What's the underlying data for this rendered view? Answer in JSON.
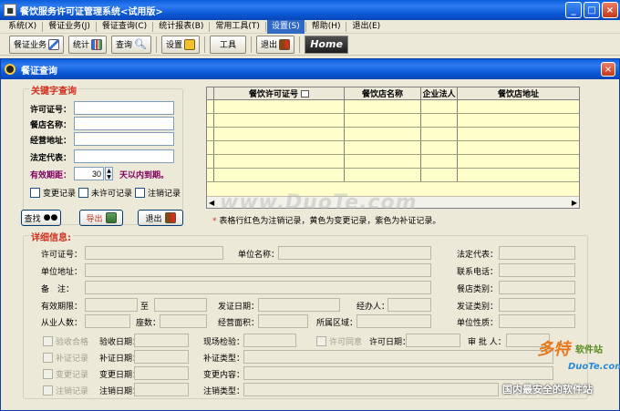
{
  "window": {
    "title": "餐饮服务许可证管理系统<试用版>",
    "controls": [
      "_",
      "□",
      "×"
    ]
  },
  "menu": [
    "系统(X)",
    "餐证业务(J)",
    "餐证查询(C)",
    "统计报表(B)",
    "常用工具(T)",
    "设置(S)",
    "帮助(H)",
    "退出(E)"
  ],
  "menu_active": 5,
  "toolbar": {
    "b1": "餐证业务",
    "b2": "统计",
    "b3": "查询",
    "b4": "设置",
    "b5": "工具",
    "b6": "退出",
    "home": "Home"
  },
  "sub": {
    "title": "餐证查询",
    "close": "×"
  },
  "keyword": {
    "title": "关键字查询",
    "license_label": "许可证号：",
    "license_value": "",
    "shop_label": "餐店名称：",
    "address_label": "经营地址：",
    "rep_label": "法定代表：",
    "period_label": "有效期距：",
    "period_value": "30",
    "period_suffix": "天以内到期。",
    "cb_change": "变更记录",
    "cb_unlicensed": "未许可记录",
    "cb_cancel": "注销记录"
  },
  "grid": {
    "headers": [
      "餐饮许可证号",
      "餐饮店名称",
      "企业法人",
      "餐饮店地址"
    ],
    "row_count": 6
  },
  "buttons": {
    "search": "查找",
    "export": "导出",
    "exit": "退出"
  },
  "note": {
    "star": "*",
    "text": "表格行红色为注销记录，黄色为变更记录，紫色为补证记录。"
  },
  "detail": {
    "title": "详细信息:",
    "license_no": "许可证号：",
    "unit_name": "单位名称：",
    "legal_rep": "法定代表：",
    "unit_addr": "单位地址：",
    "contact": "联系电话：",
    "remark": "备　注：",
    "shop_type": "餐店类别：",
    "valid": "有效期限：",
    "to": "至",
    "issue_date": "发证日期：",
    "handler": "经办人：",
    "issue_type": "发证类别：",
    "staff": "从业人数：",
    "seats": "座数：",
    "area": "经营面积：",
    "district": "所属区域：",
    "unit_nature": "单位性质：",
    "accept_cb": "验收合格",
    "accept_date": "验收日期：",
    "site_check": "现场检验：",
    "permit_ok": "许可同意",
    "permit_date": "许可日期：",
    "approver": "审 批 人：",
    "supp_cb": "补证记录",
    "supp_date": "补证日期：",
    "supp_type": "补证类型：",
    "change_cb": "变更记录",
    "change_date": "变更日期：",
    "change_content": "变更内容：",
    "cancel_cb": "注销记录",
    "cancel_date": "注销日期：",
    "cancel_type": "注销类型："
  },
  "watermark": "www.DuoTe.com",
  "brand": {
    "big": "多特",
    "small": "软件站",
    "url": "DuoTe.com",
    "slogan": "国内最安全的软件站"
  }
}
